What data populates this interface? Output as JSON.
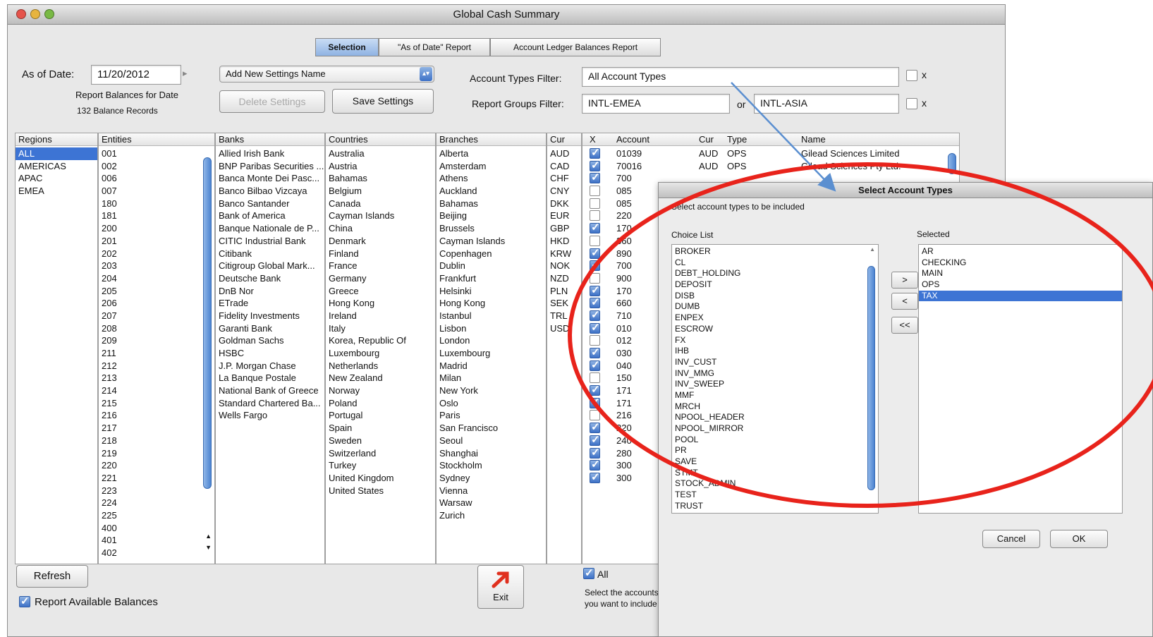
{
  "window": {
    "title": "Global Cash Summary"
  },
  "tabs": [
    {
      "label": "Selection",
      "active": true
    },
    {
      "label": "\"As of Date\" Report",
      "active": false
    },
    {
      "label": "Account Ledger Balances Report",
      "active": false
    }
  ],
  "as_of": {
    "label": "As of Date:",
    "value": "11/20/2012",
    "arrow": "▸",
    "report_label": "Report Balances for Date",
    "records": "132 Balance Records"
  },
  "settings": {
    "dropdown_value": "Add New Settings Name",
    "delete_label": "Delete Settings",
    "save_label": "Save Settings"
  },
  "filters": {
    "account_types_label": "Account Types Filter:",
    "account_types_value": "All Account Types",
    "report_groups_label": "Report Groups Filter:",
    "report_groups_value_1": "INTL-EMEA",
    "or_label": "or",
    "report_groups_value_2": "INTL-ASIA",
    "clear_mark": "x"
  },
  "lists": {
    "regions": {
      "header": "Regions",
      "items": [
        "ALL",
        "AMERICAS",
        "APAC",
        "EMEA"
      ],
      "selected": 0
    },
    "entities": {
      "header": "Entities",
      "items": [
        "001",
        "002",
        "006",
        "007",
        "180",
        "181",
        "200",
        "201",
        "202",
        "203",
        "204",
        "205",
        "206",
        "207",
        "208",
        "209",
        "211",
        "212",
        "213",
        "214",
        "215",
        "216",
        "217",
        "218",
        "219",
        "220",
        "221",
        "223",
        "224",
        "225",
        "400",
        "401",
        "402"
      ]
    },
    "banks": {
      "header": "Banks",
      "items": [
        "Allied Irish Bank",
        "BNP Paribas Securities ...",
        "Banca Monte Dei Pasc...",
        "Banco Bilbao Vizcaya",
        "Banco Santander",
        "Bank of America",
        "Banque Nationale de P...",
        "CITIC Industrial Bank",
        "Citibank",
        "Citigroup Global Mark...",
        "Deutsche Bank",
        "DnB Nor",
        "ETrade",
        "Fidelity Investments",
        "Garanti Bank",
        "Goldman Sachs",
        "HSBC",
        "J.P. Morgan Chase",
        "La Banque Postale",
        "National Bank of Greece",
        "Standard Chartered Ba...",
        "Wells Fargo"
      ]
    },
    "countries": {
      "header": "Countries",
      "items": [
        "Australia",
        "Austria",
        "Bahamas",
        "Belgium",
        "Canada",
        "Cayman Islands",
        "China",
        "Denmark",
        "Finland",
        "France",
        "Germany",
        "Greece",
        "Hong Kong",
        "Ireland",
        "Italy",
        "Korea, Republic Of",
        "Luxembourg",
        "Netherlands",
        "New Zealand",
        "Norway",
        "Poland",
        "Portugal",
        "Spain",
        "Sweden",
        "Switzerland",
        "Turkey",
        "United Kingdom",
        "United States"
      ]
    },
    "branches": {
      "header": "Branches",
      "items": [
        "Alberta",
        "Amsterdam",
        "Athens",
        "Auckland",
        "Bahamas",
        "Beijing",
        "Brussels",
        "Cayman Islands",
        "Copenhagen",
        "Dublin",
        "Frankfurt",
        "Helsinki",
        "Hong Kong",
        "Istanbul",
        "Lisbon",
        "London",
        "Luxembourg",
        "Madrid",
        "Milan",
        "New York",
        "Oslo",
        "Paris",
        "San Francisco",
        "Seoul",
        "Shanghai",
        "Stockholm",
        "Sydney",
        "Vienna",
        "Warsaw",
        "Zurich"
      ]
    },
    "currencies": {
      "header": "Cur",
      "items": [
        "AUD",
        "CAD",
        "CHF",
        "CNY",
        "DKK",
        "EUR",
        "GBP",
        "HKD",
        "KRW",
        "NOK",
        "NZD",
        "PLN",
        "SEK",
        "TRL",
        "USD"
      ]
    }
  },
  "accounts": {
    "headers": {
      "x": "X",
      "account": "Account",
      "cur": "Cur",
      "type": "Type",
      "name": "Name"
    },
    "rows": [
      {
        "checked": true,
        "account": "01039",
        "cur": "AUD",
        "type": "OPS",
        "name": "Gilead Sciences Limited"
      },
      {
        "checked": true,
        "account": "70016",
        "cur": "AUD",
        "type": "OPS",
        "name": "Gilead Sciences Pty Ltd."
      },
      {
        "checked": true,
        "account": "700",
        "cur": "",
        "type": "",
        "name": ""
      },
      {
        "checked": false,
        "account": "085",
        "cur": "",
        "type": "",
        "name": ""
      },
      {
        "checked": false,
        "account": "085",
        "cur": "",
        "type": "",
        "name": ""
      },
      {
        "checked": false,
        "account": "220",
        "cur": "",
        "type": "",
        "name": ""
      },
      {
        "checked": true,
        "account": "170",
        "cur": "",
        "type": "",
        "name": ""
      },
      {
        "checked": false,
        "account": "360",
        "cur": "",
        "type": "",
        "name": ""
      },
      {
        "checked": true,
        "account": "890",
        "cur": "",
        "type": "",
        "name": ""
      },
      {
        "checked": true,
        "account": "700",
        "cur": "",
        "type": "",
        "name": ""
      },
      {
        "checked": false,
        "account": "900",
        "cur": "",
        "type": "",
        "name": ""
      },
      {
        "checked": true,
        "account": "170",
        "cur": "",
        "type": "",
        "name": ""
      },
      {
        "checked": true,
        "account": "660",
        "cur": "",
        "type": "",
        "name": ""
      },
      {
        "checked": true,
        "account": "710",
        "cur": "",
        "type": "",
        "name": ""
      },
      {
        "checked": true,
        "account": "010",
        "cur": "",
        "type": "",
        "name": ""
      },
      {
        "checked": false,
        "account": "012",
        "cur": "",
        "type": "",
        "name": ""
      },
      {
        "checked": true,
        "account": "030",
        "cur": "",
        "type": "",
        "name": ""
      },
      {
        "checked": true,
        "account": "040",
        "cur": "",
        "type": "",
        "name": ""
      },
      {
        "checked": false,
        "account": "150",
        "cur": "",
        "type": "",
        "name": ""
      },
      {
        "checked": true,
        "account": "171",
        "cur": "",
        "type": "",
        "name": ""
      },
      {
        "checked": true,
        "account": "171",
        "cur": "",
        "type": "",
        "name": ""
      },
      {
        "checked": false,
        "account": "216",
        "cur": "",
        "type": "",
        "name": ""
      },
      {
        "checked": true,
        "account": "220",
        "cur": "",
        "type": "",
        "name": ""
      },
      {
        "checked": true,
        "account": "240",
        "cur": "",
        "type": "",
        "name": ""
      },
      {
        "checked": true,
        "account": "280",
        "cur": "",
        "type": "",
        "name": ""
      },
      {
        "checked": true,
        "account": "300",
        "cur": "",
        "type": "",
        "name": ""
      },
      {
        "checked": true,
        "account": "300",
        "cur": "",
        "type": "",
        "name": ""
      }
    ],
    "all_label": "All",
    "hint_line1": "Select the accounts",
    "hint_line2": "you want to include"
  },
  "bottom": {
    "refresh_label": "Refresh",
    "report_available_label": "Report Available Balances",
    "exit_label": "Exit"
  },
  "dialog": {
    "title": "Select Account Types",
    "instruction": "Select account types to be included",
    "choice_header": "Choice List",
    "selected_header": "Selected",
    "choice_items": [
      "BROKER",
      "CL",
      "DEBT_HOLDING",
      "DEPOSIT",
      "DISB",
      "DUMB",
      "ENPEX",
      "ESCROW",
      "FX",
      "IHB",
      "INV_CUST",
      "INV_MMG",
      "INV_SWEEP",
      "MMF",
      "MRCH",
      "NPOOL_HEADER",
      "NPOOL_MIRROR",
      "POOL",
      "PR",
      "SAVE",
      "STMT",
      "STOCK_ADMIN",
      "TEST",
      "TRUST"
    ],
    "selected_items": [
      "AR",
      "CHECKING",
      "MAIN",
      "OPS",
      "TAX"
    ],
    "selected_index": 4,
    "move_right": ">",
    "move_left": "<",
    "move_all_left": "<<",
    "cancel_label": "Cancel",
    "ok_label": "OK"
  },
  "colors": {
    "selection": "#3d74d4",
    "annotation_ellipse": "#e8231b",
    "annotation_arrow": "#5b8fd0",
    "exit_arrow": "#e0301e"
  }
}
